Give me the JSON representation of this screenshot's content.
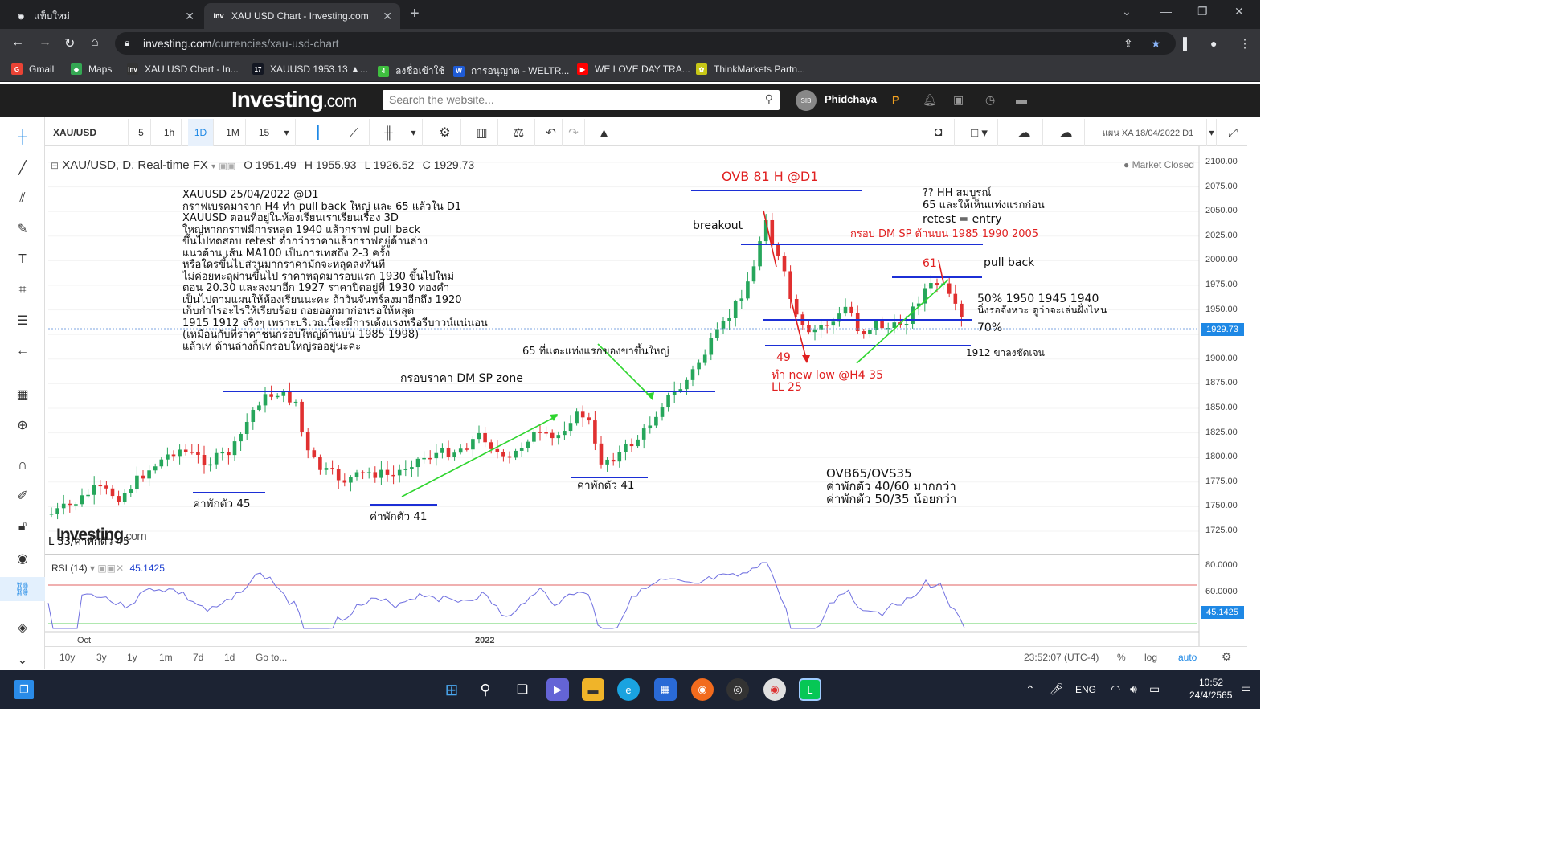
{
  "browser": {
    "tabs": [
      {
        "title": "แท็บใหม่",
        "active": false
      },
      {
        "title": "XAU USD Chart - Investing.com",
        "active": true
      }
    ],
    "url_host": "investing.com",
    "url_path": "/currencies/xau-usd-chart",
    "bookmarks": [
      {
        "label": "Gmail",
        "icon": "gmail-icon",
        "color": "#ea4335",
        "glyph": "G"
      },
      {
        "label": "Maps",
        "icon": "maps-icon",
        "color": "#34a853",
        "glyph": "◆"
      },
      {
        "label": "XAU USD Chart - In...",
        "icon": "investing-icon",
        "color": "#333",
        "glyph": "Inv"
      },
      {
        "label": "XAUUSD 1953.13 ▲...",
        "icon": "tradingview-icon",
        "color": "#131722",
        "glyph": "17"
      },
      {
        "label": "ลงชื่อเข้าใช้",
        "icon": "signin-icon",
        "color": "#3fbf3f",
        "glyph": "4"
      },
      {
        "label": "การอนุญาต - WELTR...",
        "icon": "weltrade-icon",
        "color": "#1e5bd6",
        "glyph": "W"
      },
      {
        "label": "WE LOVE DAY TRA...",
        "icon": "youtube-icon",
        "color": "#ff0000",
        "glyph": "▶"
      },
      {
        "label": "ThinkMarkets Partn...",
        "icon": "thinkmarkets-icon",
        "color": "#c7c716",
        "glyph": "✿"
      }
    ]
  },
  "site": {
    "logo_main": "Investing",
    "logo_suffix": ".com",
    "search_placeholder": "Search the website...",
    "avatar_text": "SIB",
    "user_name": "Phidchaya"
  },
  "toolbar": {
    "symbol": "XAU/USD",
    "timeframes": [
      "5",
      "1h",
      "1D",
      "1M",
      "15"
    ],
    "selected_timeframe": "1D",
    "layout_name": "แผน XA 18/04/2022 D1"
  },
  "legend": {
    "title": "XAU/USD, D, Real-time FX",
    "open": "O 1951.49",
    "high": "H 1955.93",
    "low": "L 1926.52",
    "close": "C 1929.73",
    "market_status": "Market Closed"
  },
  "rsi": {
    "label": "RSI (14)",
    "value": "45.1425"
  },
  "price_axis": {
    "ticks": [
      "2100.00",
      "2075.00",
      "2050.00",
      "2025.00",
      "2000.00",
      "1975.00",
      "1950.00",
      "1925.00",
      "1900.00",
      "1875.00",
      "1850.00",
      "1825.00",
      "1800.00",
      "1775.00",
      "1750.00",
      "1725.00"
    ],
    "last_price": "1929.73",
    "rsi_ticks": [
      "80.0000",
      "60.0000"
    ]
  },
  "time_axis": {
    "ticks": [
      "Oct",
      "2022"
    ]
  },
  "annotations": {
    "main_note": "XAUUSD 25/04/2022 @D1\nกราฟเบรคมาจาก H4 ทำ pull back ใหญ่ และ 65 แล้วใน D1\nXAUUSD ตอนที่อยู่ในห้องเรียนเราเรียนเรื่อง 3D\nใหญ่หากกราฟมีการหลุด 1940 แล้วกราฟ pull back\nขึ้นไปทดสอบ retest ต่ำกว่าราคาแล้วกราฟอยู่ด้านล่าง\nแนวต้าน เส้น MA100 เป็นการเทสถึง 2-3 ครั้ง\nหรือใดรขึ้นไปส่วนมากราคามักจะหลุดลงทันที\nไม่ค่อยทะลุผ่านขึ้นไป ราคาหลุดมารอบแรก 1930 ขึ้นไปใหม่\nตอน 20.30 และลงมาอีก 1927 ราคาปิดอยู่ที่ 1930 ทองคำ\nเป็นไปตามแผนให้ห้องเรียนนะคะ ถ้าวันจันทร์ลงมาอีกถึง 1920\nเก็บกำไรอะไรให้เรียบร้อย ถอยออกมาก่อนรอให้หลุด\n1915 1912 จริงๆ เพราะบริเวณนี้จะมีการเด้งแรงหรือรีบาวน์แน่นอน\n(เหมือนกับที่ราคาชนกรอบใหญ่ด้านบน 1985 1998)\nแล้วเท่ ด้านล่างก็มีกรอบใหญ่รออยู่นะคะ",
    "ovb": "OVB 81 H @D1",
    "breakout": "breakout",
    "hh_note": "?? HH สมบูรณ์\n65 และให้เห็นแท่งแรกก่อน",
    "retest": "retest = entry",
    "dm_sp_top": "กรอบ DM SP ด้านบน 1985 1990 2005",
    "n61": "61",
    "pull_back": "pull back",
    "fifty": "50% 1950 1945 1940",
    "wait_note": "นิ่งรอจังหวะ ดูว่าจะเล่นฝั่งไหน",
    "seventy": "70%",
    "n49": "49",
    "new_low": "ทำ new low @H4 35\nLL 25",
    "n1912": "1912 ขาลงชัดเจน",
    "sixty_five": "65 ที่แตะแท่งแรกของขาขึ้นใหญ่",
    "dm_sp_zone": "กรอบราคา DM SP zone",
    "pull45": "ค่าพักตัว 45",
    "pull41a": "ค่าพักตัว 41",
    "pull41b": "ค่าพักตัว 41",
    "ovb_summary": "OVB65/OVS35\nค่าพักตัว 40/60 มากกว่า\nค่าพักตัว 50/35 น้อยกว่า",
    "watermark_main": "Investing",
    "watermark_suffix": ".com",
    "low_label": "L 53/ค่าพักตัว 45"
  },
  "bottom": {
    "ranges": [
      "10y",
      "3y",
      "1y",
      "1m",
      "7d",
      "1d"
    ],
    "goto": "Go to...",
    "clock": "23:52:07 (UTC-4)",
    "percent": "%",
    "log": "log",
    "auto": "auto"
  },
  "taskbar": {
    "lang": "ENG",
    "time": "10:52",
    "date": "24/4/2565"
  }
}
